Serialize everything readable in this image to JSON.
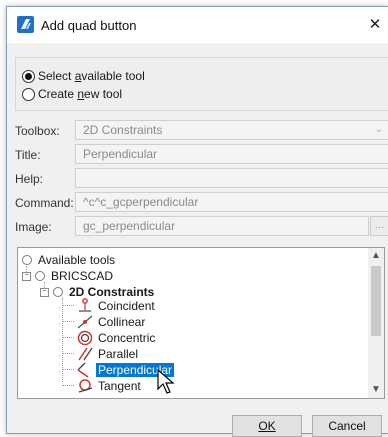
{
  "window": {
    "title": "Add quad button",
    "close_glyph": "✕"
  },
  "mode": {
    "options": [
      {
        "label": "Select available tool",
        "accesskey_char": "a",
        "checked": true
      },
      {
        "label": "Create new tool",
        "accesskey_char": "n",
        "checked": false
      }
    ]
  },
  "fields": {
    "toolbox": {
      "label": "Toolbox:",
      "value": "2D Constraints"
    },
    "title": {
      "label": "Title:",
      "value": "Perpendicular"
    },
    "help": {
      "label": "Help:",
      "value": ""
    },
    "command": {
      "label": "Command:",
      "value": "^c^c_gcperpendicular"
    },
    "image": {
      "label": "Image:",
      "value": "gc_perpendicular",
      "browse_label": "..."
    }
  },
  "tree": {
    "root": "Available tools",
    "group": "BRICSCAD",
    "category": "2D Constraints",
    "items": [
      {
        "label": "Coincident",
        "icon": "coincident-icon"
      },
      {
        "label": "Collinear",
        "icon": "collinear-icon"
      },
      {
        "label": "Concentric",
        "icon": "concentric-icon"
      },
      {
        "label": "Parallel",
        "icon": "parallel-icon"
      },
      {
        "label": "Perpendicular",
        "icon": "perpendicular-icon",
        "selected": true
      },
      {
        "label": "Tangent",
        "icon": "tangent-icon"
      }
    ]
  },
  "buttons": {
    "ok": "OK",
    "cancel": "Cancel"
  },
  "colors": {
    "selection": "#0078d7",
    "app_icon": "#1f72c9",
    "constraint_red": "#d0342c"
  }
}
